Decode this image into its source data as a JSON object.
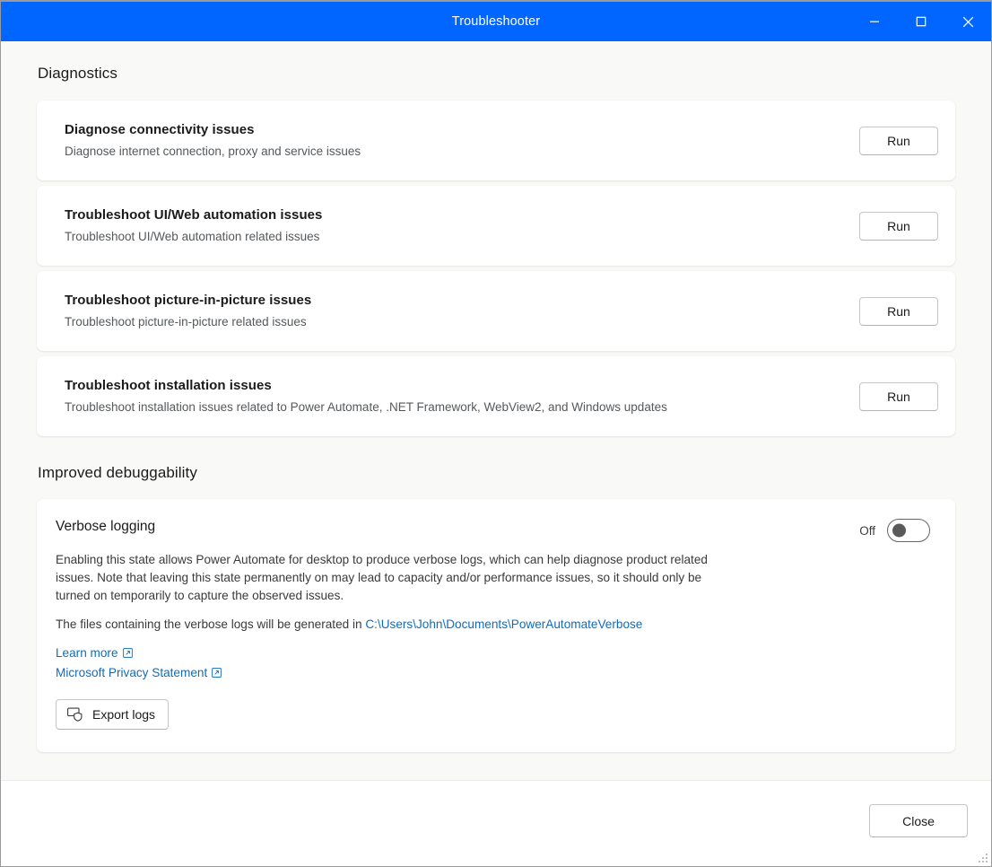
{
  "window": {
    "title": "Troubleshooter",
    "accent_color": "#0066ff",
    "controls": {
      "minimize": "Minimize",
      "maximize": "Maximize",
      "close": "Close"
    }
  },
  "sections": {
    "diagnostics": {
      "heading": "Diagnostics",
      "items": [
        {
          "title": "Diagnose connectivity issues",
          "subtitle": "Diagnose internet connection, proxy and service issues",
          "action": "Run"
        },
        {
          "title": "Troubleshoot UI/Web automation issues",
          "subtitle": "Troubleshoot UI/Web automation related issues",
          "action": "Run"
        },
        {
          "title": "Troubleshoot picture-in-picture issues",
          "subtitle": "Troubleshoot picture-in-picture related issues",
          "action": "Run"
        },
        {
          "title": "Troubleshoot installation issues",
          "subtitle": "Troubleshoot installation issues related to Power Automate, .NET Framework, WebView2, and Windows updates",
          "action": "Run"
        }
      ]
    },
    "debuggability": {
      "heading": "Improved debuggability",
      "verbose": {
        "title": "Verbose logging",
        "toggle_label": "Off",
        "toggle_state": "off",
        "description": "Enabling this state allows Power Automate for desktop to produce verbose logs, which can help diagnose product related issues. Note that leaving this state permanently on may lead to capacity and/or performance issues, so it should only be turned on temporarily to capture the observed issues.",
        "path_prefix": "The files containing the verbose logs will be generated in ",
        "path_value": "C:\\Users\\John\\Documents\\PowerAutomateVerbose",
        "links": [
          {
            "label": "Learn more",
            "icon": "external-link-icon"
          },
          {
            "label": "Microsoft Privacy Statement",
            "icon": "external-link-icon"
          }
        ],
        "export_button": {
          "label": "Export logs",
          "icon": "export-logs-shield-icon"
        }
      }
    }
  },
  "footer": {
    "close_label": "Close"
  },
  "colors": {
    "link": "#0f6cbd",
    "content_bg": "#f9f9f8",
    "card_bg": "#ffffff"
  }
}
